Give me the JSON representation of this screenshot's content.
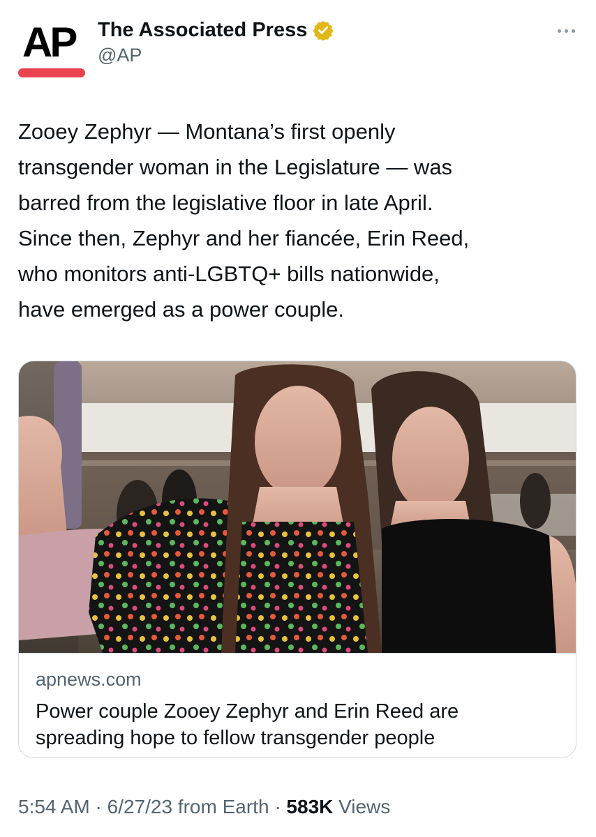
{
  "account": {
    "logo_text": "AP",
    "name": "The Associated Press",
    "handle": "@AP",
    "verified_icon": "gold-verified-badge-icon",
    "brand_color": "#e8434f"
  },
  "tweet": {
    "text": "Zooey Zephyr — Montana’s first openly\ntransgender woman in the Legislature — was\nbarred from the legislative floor in late April.\nSince then, Zephyr and her fiancée, Erin Reed,\nwho monitors anti-LGBTQ+ bills nationwide,\nhave emerged as a power couple."
  },
  "card": {
    "domain": "apnews.com",
    "title": "Power couple Zooey Zephyr and Erin Reed are spreading hope to fellow transgender people"
  },
  "footer": {
    "time": "5:54 AM",
    "sep": "·",
    "date": "6/27/23",
    "source": "from Earth",
    "views_count": "583K",
    "views_label": "Views"
  }
}
